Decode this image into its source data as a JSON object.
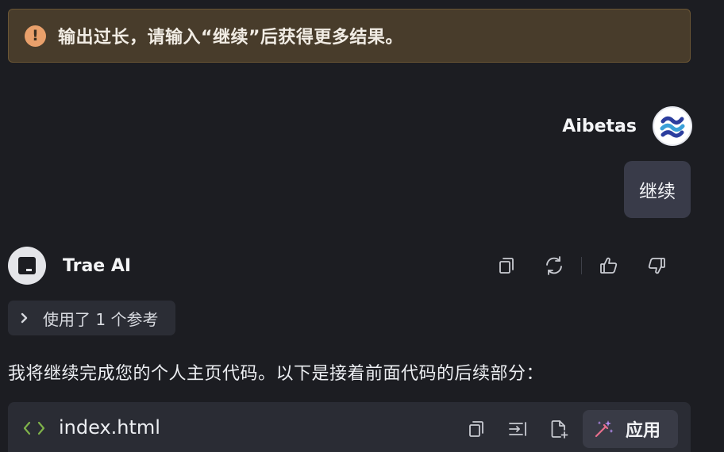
{
  "warning": {
    "icon": "exclamation-icon",
    "text": "输出过长，请输入“继续”后获得更多结果。",
    "color": "#e9a06b"
  },
  "user": {
    "name": "Aibetas",
    "message": "继续"
  },
  "assistant": {
    "name": "Trae AI",
    "actions": [
      "copy-icon",
      "regenerate-icon",
      "thumbs-up-icon",
      "thumbs-down-icon"
    ]
  },
  "reference": {
    "label": "使用了 1 个参考"
  },
  "answer": {
    "text": "我将继续完成您的个人主页代码。以下是接着前面代码的后续部分："
  },
  "code_block": {
    "file_name": "index.html",
    "apply_label": "应用",
    "accent": "#7fb24a"
  }
}
